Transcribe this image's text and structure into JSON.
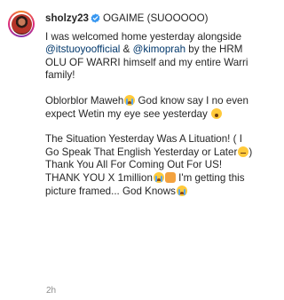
{
  "post": {
    "username": "sholzy23",
    "title": "OGAIME (SUOOOOO)",
    "p1_a": "I was welcomed home yesterday alongside ",
    "mention1": "@itstuoyoofficial",
    "p1_b": " & ",
    "mention2": "@kimoprah",
    "p1_c": " by the HRM OLU OF WARRI himself and my entire Warri family!",
    "p2_a": "Oblorblor Maweh",
    "p2_b": " God know say I no even expect Wetin my eye see yesterday ",
    "p3_a": "The Situation Yesterday Was A Lituation! ( I Go Speak That English Yesterday or Later",
    "p3_b": ") Thank You All For Coming Out For US! THANK YOU X 1million",
    "p3_c": " I'm getting this picture framed... God Knows",
    "timestamp": "2h"
  },
  "icons": {
    "verified": "verified-badge-icon",
    "emoji_cry": "loudly-crying-face-emoji",
    "emoji_surprised": "hushed-face-emoji",
    "emoji_shrug": "person-shrugging-emoji",
    "emoji_thinking": "thinking-face-emoji"
  },
  "colors": {
    "text": "#262626",
    "mention": "#00376b",
    "verified": "#3897f0",
    "timestamp": "#8e8e8e"
  }
}
